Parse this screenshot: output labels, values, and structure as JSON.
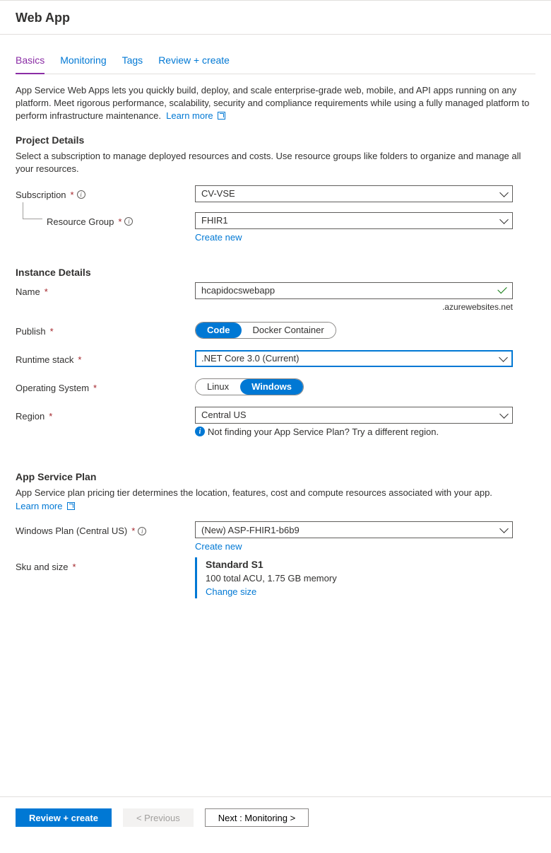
{
  "pageTitle": "Web App",
  "tabs": [
    {
      "label": "Basics",
      "active": true
    },
    {
      "label": "Monitoring",
      "active": false
    },
    {
      "label": "Tags",
      "active": false
    },
    {
      "label": "Review + create",
      "active": false
    }
  ],
  "intro": {
    "text": "App Service Web Apps lets you quickly build, deploy, and scale enterprise-grade web, mobile, and API apps running on any platform. Meet rigorous performance, scalability, security and compliance requirements while using a fully managed platform to perform infrastructure maintenance.",
    "learnMore": "Learn more"
  },
  "projectDetails": {
    "heading": "Project Details",
    "desc": "Select a subscription to manage deployed resources and costs. Use resource groups like folders to organize and manage all your resources.",
    "subscriptionLabel": "Subscription",
    "subscriptionValue": "CV-VSE",
    "resourceGroupLabel": "Resource Group",
    "resourceGroupValue": "FHIR1",
    "createNew": "Create new"
  },
  "instanceDetails": {
    "heading": "Instance Details",
    "nameLabel": "Name",
    "nameValue": "hcapidocswebapp",
    "nameSuffix": ".azurewebsites.net",
    "publishLabel": "Publish",
    "publishOptions": [
      "Code",
      "Docker Container"
    ],
    "runtimeLabel": "Runtime stack",
    "runtimeValue": ".NET Core 3.0 (Current)",
    "osLabel": "Operating System",
    "osOptions": [
      "Linux",
      "Windows"
    ],
    "regionLabel": "Region",
    "regionValue": "Central US",
    "regionHint": "Not finding your App Service Plan? Try a different region."
  },
  "appServicePlan": {
    "heading": "App Service Plan",
    "desc": "App Service plan pricing tier determines the location, features, cost and compute resources associated with your app.",
    "learnMore": "Learn more",
    "planLabel": "Windows Plan (Central US)",
    "planValue": "(New) ASP-FHIR1-b6b9",
    "createNew": "Create new",
    "skuLabel": "Sku and size",
    "skuTitle": "Standard S1",
    "skuDesc": "100 total ACU, 1.75 GB memory",
    "changeSize": "Change size"
  },
  "footer": {
    "review": "Review + create",
    "previous": "< Previous",
    "next": "Next : Monitoring >"
  }
}
